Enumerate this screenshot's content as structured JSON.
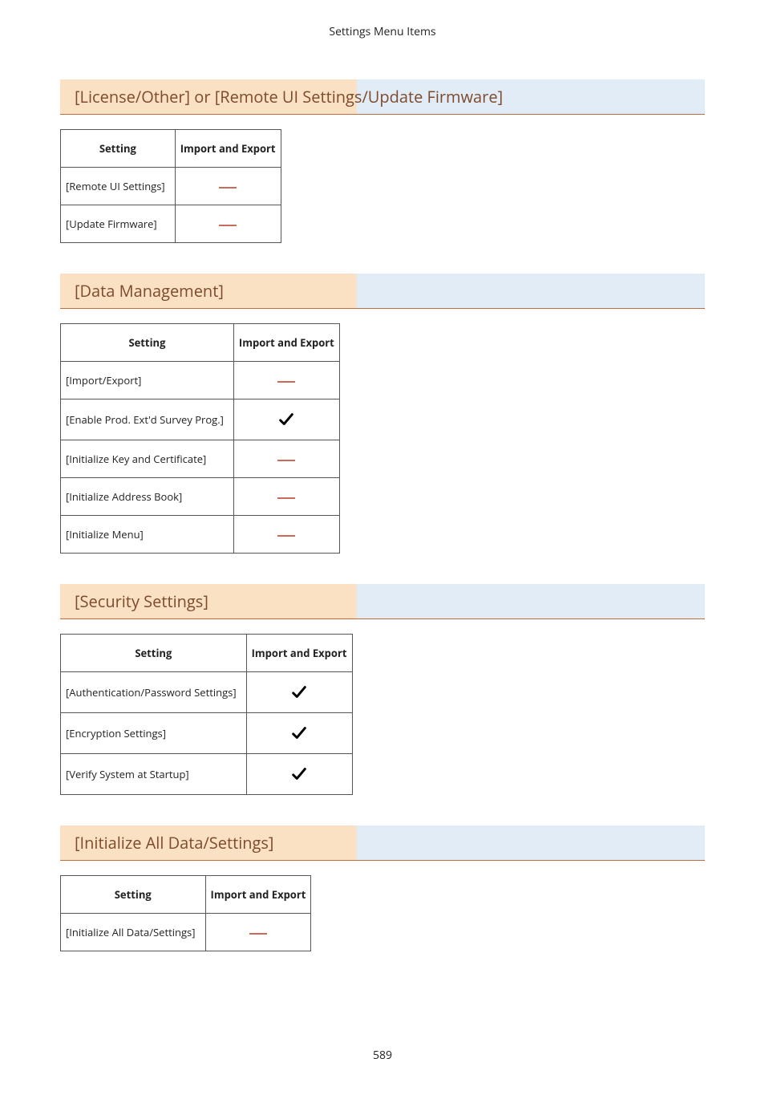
{
  "page_header": "Settings Menu Items",
  "page_number": "589",
  "table_headers": {
    "setting": "Setting",
    "import_export": "Import and Export"
  },
  "sections": [
    {
      "title": "[License/Other] or [Remote UI Settings/Update Firmware]",
      "rows": [
        {
          "label": "[Remote UI Settings]",
          "export": false
        },
        {
          "label": "[Update Firmware]",
          "export": false
        }
      ]
    },
    {
      "title": "[Data Management]",
      "rows": [
        {
          "label": "[Import/Export]",
          "export": false
        },
        {
          "label": "[Enable Prod. Ext'd Survey Prog.]",
          "export": true
        },
        {
          "label": "[Initialize Key and Certificate]",
          "export": false
        },
        {
          "label": "[Initialize Address Book]",
          "export": false
        },
        {
          "label": "[Initialize Menu]",
          "export": false
        }
      ]
    },
    {
      "title": "[Security Settings]",
      "rows": [
        {
          "label": "[Authentication/Password Settings]",
          "export": true
        },
        {
          "label": "[Encryption Settings]",
          "export": true
        },
        {
          "label": "[Verify System at Startup]",
          "export": true
        }
      ]
    },
    {
      "title": "[Initialize All Data/Settings]",
      "rows": [
        {
          "label": "[Initialize All Data/Settings]",
          "export": false
        }
      ]
    }
  ]
}
